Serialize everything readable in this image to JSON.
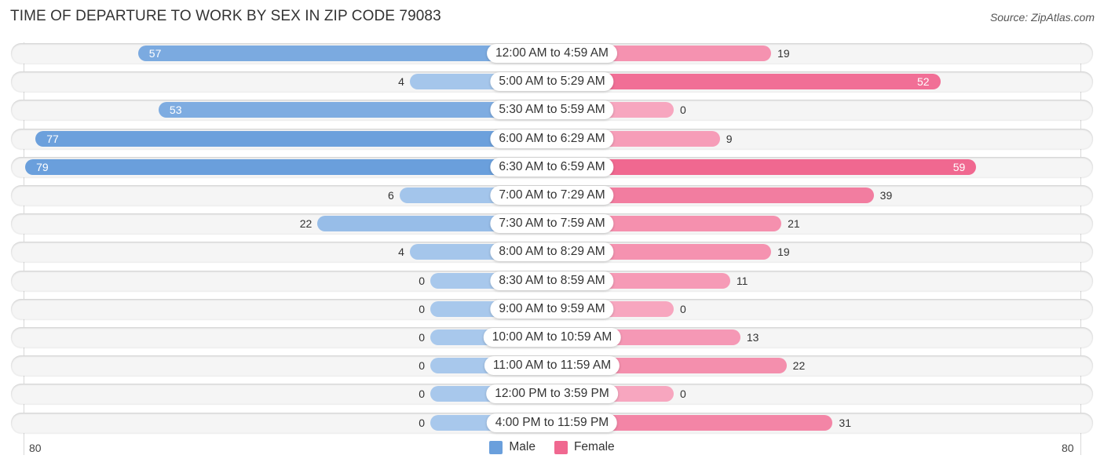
{
  "title": "TIME OF DEPARTURE TO WORK BY SEX IN ZIP CODE 79083",
  "source": "Source: ZipAtlas.com",
  "colors": {
    "male": "#6a9fdc",
    "female": "#f06890",
    "male_light": "#a8c8ec",
    "female_light": "#f7a6bf"
  },
  "chart_data": {
    "type": "bar",
    "orientation": "horizontal-diverging",
    "title": "TIME OF DEPARTURE TO WORK BY SEX IN ZIP CODE 79083",
    "categories": [
      "12:00 AM to 4:59 AM",
      "5:00 AM to 5:29 AM",
      "5:30 AM to 5:59 AM",
      "6:00 AM to 6:29 AM",
      "6:30 AM to 6:59 AM",
      "7:00 AM to 7:29 AM",
      "7:30 AM to 7:59 AM",
      "8:00 AM to 8:29 AM",
      "8:30 AM to 8:59 AM",
      "9:00 AM to 9:59 AM",
      "10:00 AM to 10:59 AM",
      "11:00 AM to 11:59 AM",
      "12:00 PM to 3:59 PM",
      "4:00 PM to 11:59 PM"
    ],
    "series": [
      {
        "name": "Male",
        "values": [
          57,
          4,
          53,
          77,
          79,
          6,
          22,
          4,
          0,
          0,
          0,
          0,
          0,
          0
        ]
      },
      {
        "name": "Female",
        "values": [
          19,
          52,
          0,
          9,
          59,
          39,
          21,
          19,
          11,
          0,
          13,
          22,
          0,
          31
        ]
      }
    ],
    "axis": {
      "left_tick": "80",
      "right_tick": "80",
      "range": [
        0,
        80
      ]
    },
    "legend": {
      "position": "bottom-center",
      "entries": [
        "Male",
        "Female"
      ]
    },
    "grid": false
  }
}
